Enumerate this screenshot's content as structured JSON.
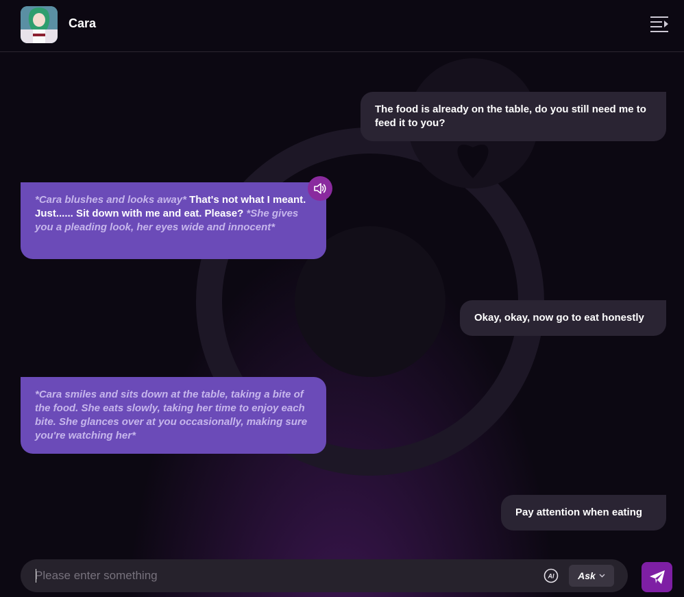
{
  "header": {
    "character_name": "Cara",
    "avatar_icon": "character-avatar",
    "menu_icon": "menu-collapse-icon"
  },
  "messages": [
    {
      "role": "user",
      "text": "The food is already on the table, do you still need me to feed it to you?"
    },
    {
      "role": "bot",
      "parts": [
        {
          "style": "action",
          "text": "*Cara blushes and looks away*"
        },
        {
          "style": "speech",
          "text": " That's not what I meant. Just...... Sit down with me and eat. Please? "
        },
        {
          "style": "action",
          "text": "*She gives you a pleading look, her eyes wide and innocent*"
        }
      ],
      "speaker_icon": "speaker-icon"
    },
    {
      "role": "user",
      "text": "Okay, okay, now go to eat honestly"
    },
    {
      "role": "bot",
      "parts": [
        {
          "style": "action",
          "text": "*Cara smiles and sits down at the table, taking a bite of the food. She eats slowly, taking her time to enjoy each bite. She glances over at you occasionally, making sure you're watching her*"
        }
      ]
    },
    {
      "role": "user",
      "text": "Pay attention when eating"
    }
  ],
  "composer": {
    "placeholder": "Please enter something",
    "value": "",
    "ai_icon": "ai-icon",
    "mode_label": "Ask",
    "send_icon": "send-icon"
  },
  "colors": {
    "background": "#0c0812",
    "user_bubble": "#2a2433",
    "bot_bubble": "#6b4bb8",
    "action_text": "#c6b6ec",
    "accent": "#7e1fa4"
  }
}
